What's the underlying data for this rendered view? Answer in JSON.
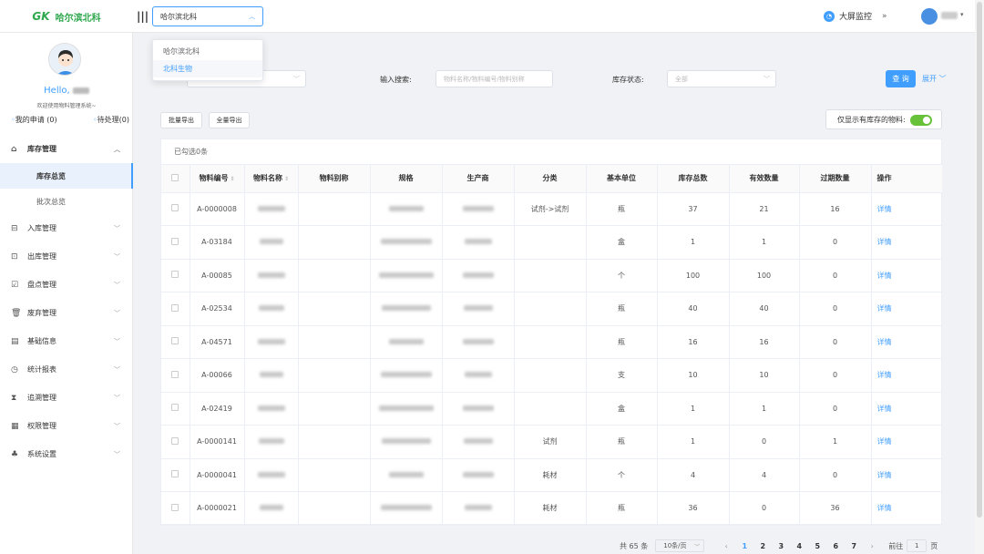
{
  "app": {
    "logo_mark": "GK",
    "logo_text": "哈尔滨北科"
  },
  "header": {
    "org_selected": "哈尔滨北科",
    "org_options": [
      "哈尔滨北科",
      "北科生物"
    ],
    "monitor_label": "大屏监控"
  },
  "sidebar": {
    "hello": "Hello,",
    "welcome": "欢迎使用物料管理系统~",
    "my_apply": "我的申请 (0)",
    "pending": "待处理(0)",
    "menu": [
      {
        "label": "库存管理",
        "icon": "home-icon"
      },
      {
        "label": "库存总览"
      },
      {
        "label": "批次总览"
      },
      {
        "label": "入库管理",
        "icon": "inbound-icon"
      },
      {
        "label": "出库管理",
        "icon": "outbound-icon"
      },
      {
        "label": "盘点管理",
        "icon": "checklist-icon"
      },
      {
        "label": "废弃管理",
        "icon": "trash-icon"
      },
      {
        "label": "基础信息",
        "icon": "document-icon"
      },
      {
        "label": "统计报表",
        "icon": "clock-icon"
      },
      {
        "label": "追溯管理",
        "icon": "hourglass-icon"
      },
      {
        "label": "权限管理",
        "icon": "grid-icon"
      },
      {
        "label": "系统设置",
        "icon": "org-icon"
      }
    ]
  },
  "filters": {
    "search_label": "输入搜索:",
    "search_placeholder": "物料名称/物料编号/物料别称",
    "status_label": "库存状态:",
    "status_value": "全部",
    "query_btn": "查 询",
    "expand_btn": "展开"
  },
  "toolbar": {
    "batch_export": "批量导出",
    "all_export": "全量导出",
    "only_stock_label": "仅显示有库存的物料:"
  },
  "table": {
    "selected_info": "已勾选0条",
    "headers": [
      "物料编号",
      "物料名称",
      "物料别称",
      "规格",
      "生产商",
      "分类",
      "基本单位",
      "库存总数",
      "有效数量",
      "过期数量",
      "操作"
    ],
    "rows": [
      {
        "code": "A-0000008",
        "category": "试剂->试剂",
        "unit": "瓶",
        "total": "37",
        "valid": "21",
        "expired": "16",
        "action": "详情"
      },
      {
        "code": "A-03184",
        "category": "",
        "unit": "盒",
        "total": "1",
        "valid": "1",
        "expired": "0",
        "action": "详情"
      },
      {
        "code": "A-00085",
        "category": "",
        "unit": "个",
        "total": "100",
        "valid": "100",
        "expired": "0",
        "action": "详情"
      },
      {
        "code": "A-02534",
        "category": "",
        "unit": "瓶",
        "total": "40",
        "valid": "40",
        "expired": "0",
        "action": "详情"
      },
      {
        "code": "A-04571",
        "category": "",
        "unit": "瓶",
        "total": "16",
        "valid": "16",
        "expired": "0",
        "action": "详情"
      },
      {
        "code": "A-00066",
        "category": "",
        "unit": "支",
        "total": "10",
        "valid": "10",
        "expired": "0",
        "action": "详情"
      },
      {
        "code": "A-02419",
        "category": "",
        "unit": "盒",
        "total": "1",
        "valid": "1",
        "expired": "0",
        "action": "详情"
      },
      {
        "code": "A-0000141",
        "category": "试剂",
        "unit": "瓶",
        "total": "1",
        "valid": "0",
        "expired": "1",
        "action": "详情"
      },
      {
        "code": "A-0000041",
        "category": "耗材",
        "unit": "个",
        "total": "4",
        "valid": "4",
        "expired": "0",
        "action": "详情"
      },
      {
        "code": "A-0000021",
        "category": "耗材",
        "unit": "瓶",
        "total": "36",
        "valid": "0",
        "expired": "36",
        "action": "详情"
      }
    ]
  },
  "pagination": {
    "total": "共 65 条",
    "page_size": "10条/页",
    "pages": [
      "1",
      "2",
      "3",
      "4",
      "5",
      "6",
      "7"
    ],
    "current": "1",
    "goto_label": "前往",
    "goto_value": "1",
    "page_suffix": "页"
  },
  "colors": {
    "primary": "#409eff",
    "brand": "#2fa84f",
    "switch_on": "#67c23a"
  }
}
